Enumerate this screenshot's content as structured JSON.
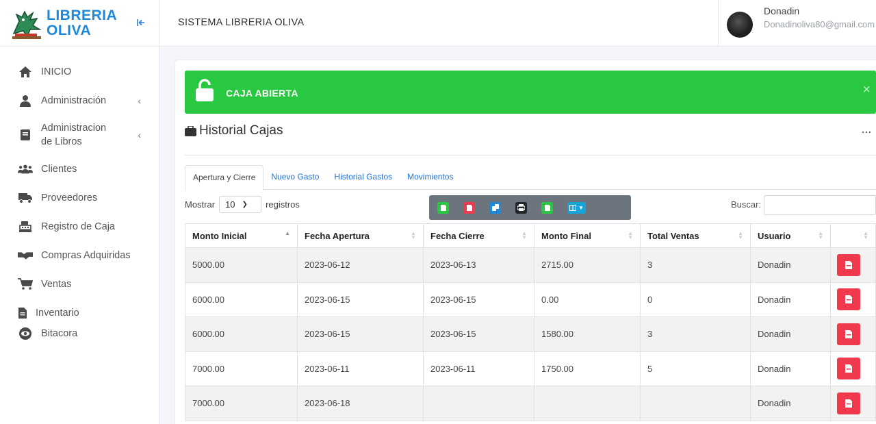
{
  "brand": {
    "line1": "LIBRERIA",
    "line2": "OLIVA"
  },
  "sidebar": {
    "items": [
      {
        "label": "INICIO",
        "icon": "home-icon"
      },
      {
        "label": "Administración",
        "icon": "user-icon",
        "has_submenu": true
      },
      {
        "label": "Administracion de Libros",
        "icon": "book-icon",
        "has_submenu": true
      },
      {
        "label": "Clientes",
        "icon": "users-icon"
      },
      {
        "label": "Proveedores",
        "icon": "truck-icon"
      },
      {
        "label": "Registro de Caja",
        "icon": "cash-register-icon"
      },
      {
        "label": "Compras Adquiridas",
        "icon": "handshake-icon"
      },
      {
        "label": "Ventas",
        "icon": "cart-icon"
      },
      {
        "label": "Inventario",
        "icon": "file-icon"
      },
      {
        "label": "Bitacora",
        "icon": "eye-icon"
      }
    ]
  },
  "topbar": {
    "title": "SISTEMA LIBRERIA OLIVA",
    "user_name": "Donadin",
    "user_email": "Donadinoliva80@gmail.com"
  },
  "alert": {
    "text": "CAJA ABIERTA",
    "close": "×"
  },
  "section": {
    "title": "Historial Cajas",
    "more": "···"
  },
  "tabs": [
    "Apertura y Cierre",
    "Nuevo Gasto",
    "Historial Gastos",
    "Movimientos"
  ],
  "controls": {
    "show_label": "Mostrar",
    "page_length": "10",
    "records_label": "registros",
    "search_label": "Buscar:",
    "search_value": ""
  },
  "export_buttons": [
    "excel-icon",
    "pdf-icon",
    "copy-icon",
    "print-icon",
    "csv-icon",
    "columns-icon"
  ],
  "table": {
    "headers": [
      "Monto Inicial",
      "Fecha Apertura",
      "Fecha Cierre",
      "Monto Final",
      "Total Ventas",
      "Usuario",
      ""
    ],
    "rows": [
      [
        "5000.00",
        "2023-06-12",
        "2023-06-13",
        "2715.00",
        "3",
        "Donadin"
      ],
      [
        "6000.00",
        "2023-06-15",
        "2023-06-15",
        "0.00",
        "0",
        "Donadin"
      ],
      [
        "6000.00",
        "2023-06-15",
        "2023-06-15",
        "1580.00",
        "3",
        "Donadin"
      ],
      [
        "7000.00",
        "2023-06-11",
        "2023-06-11",
        "1750.00",
        "5",
        "Donadin"
      ],
      [
        "7000.00",
        "2023-06-18",
        "",
        "",
        "",
        "Donadin"
      ]
    ]
  },
  "colors": {
    "accent": "#1e88d8",
    "success": "#28c840",
    "danger": "#ef3a4d",
    "btn_group": "#6c757d"
  }
}
